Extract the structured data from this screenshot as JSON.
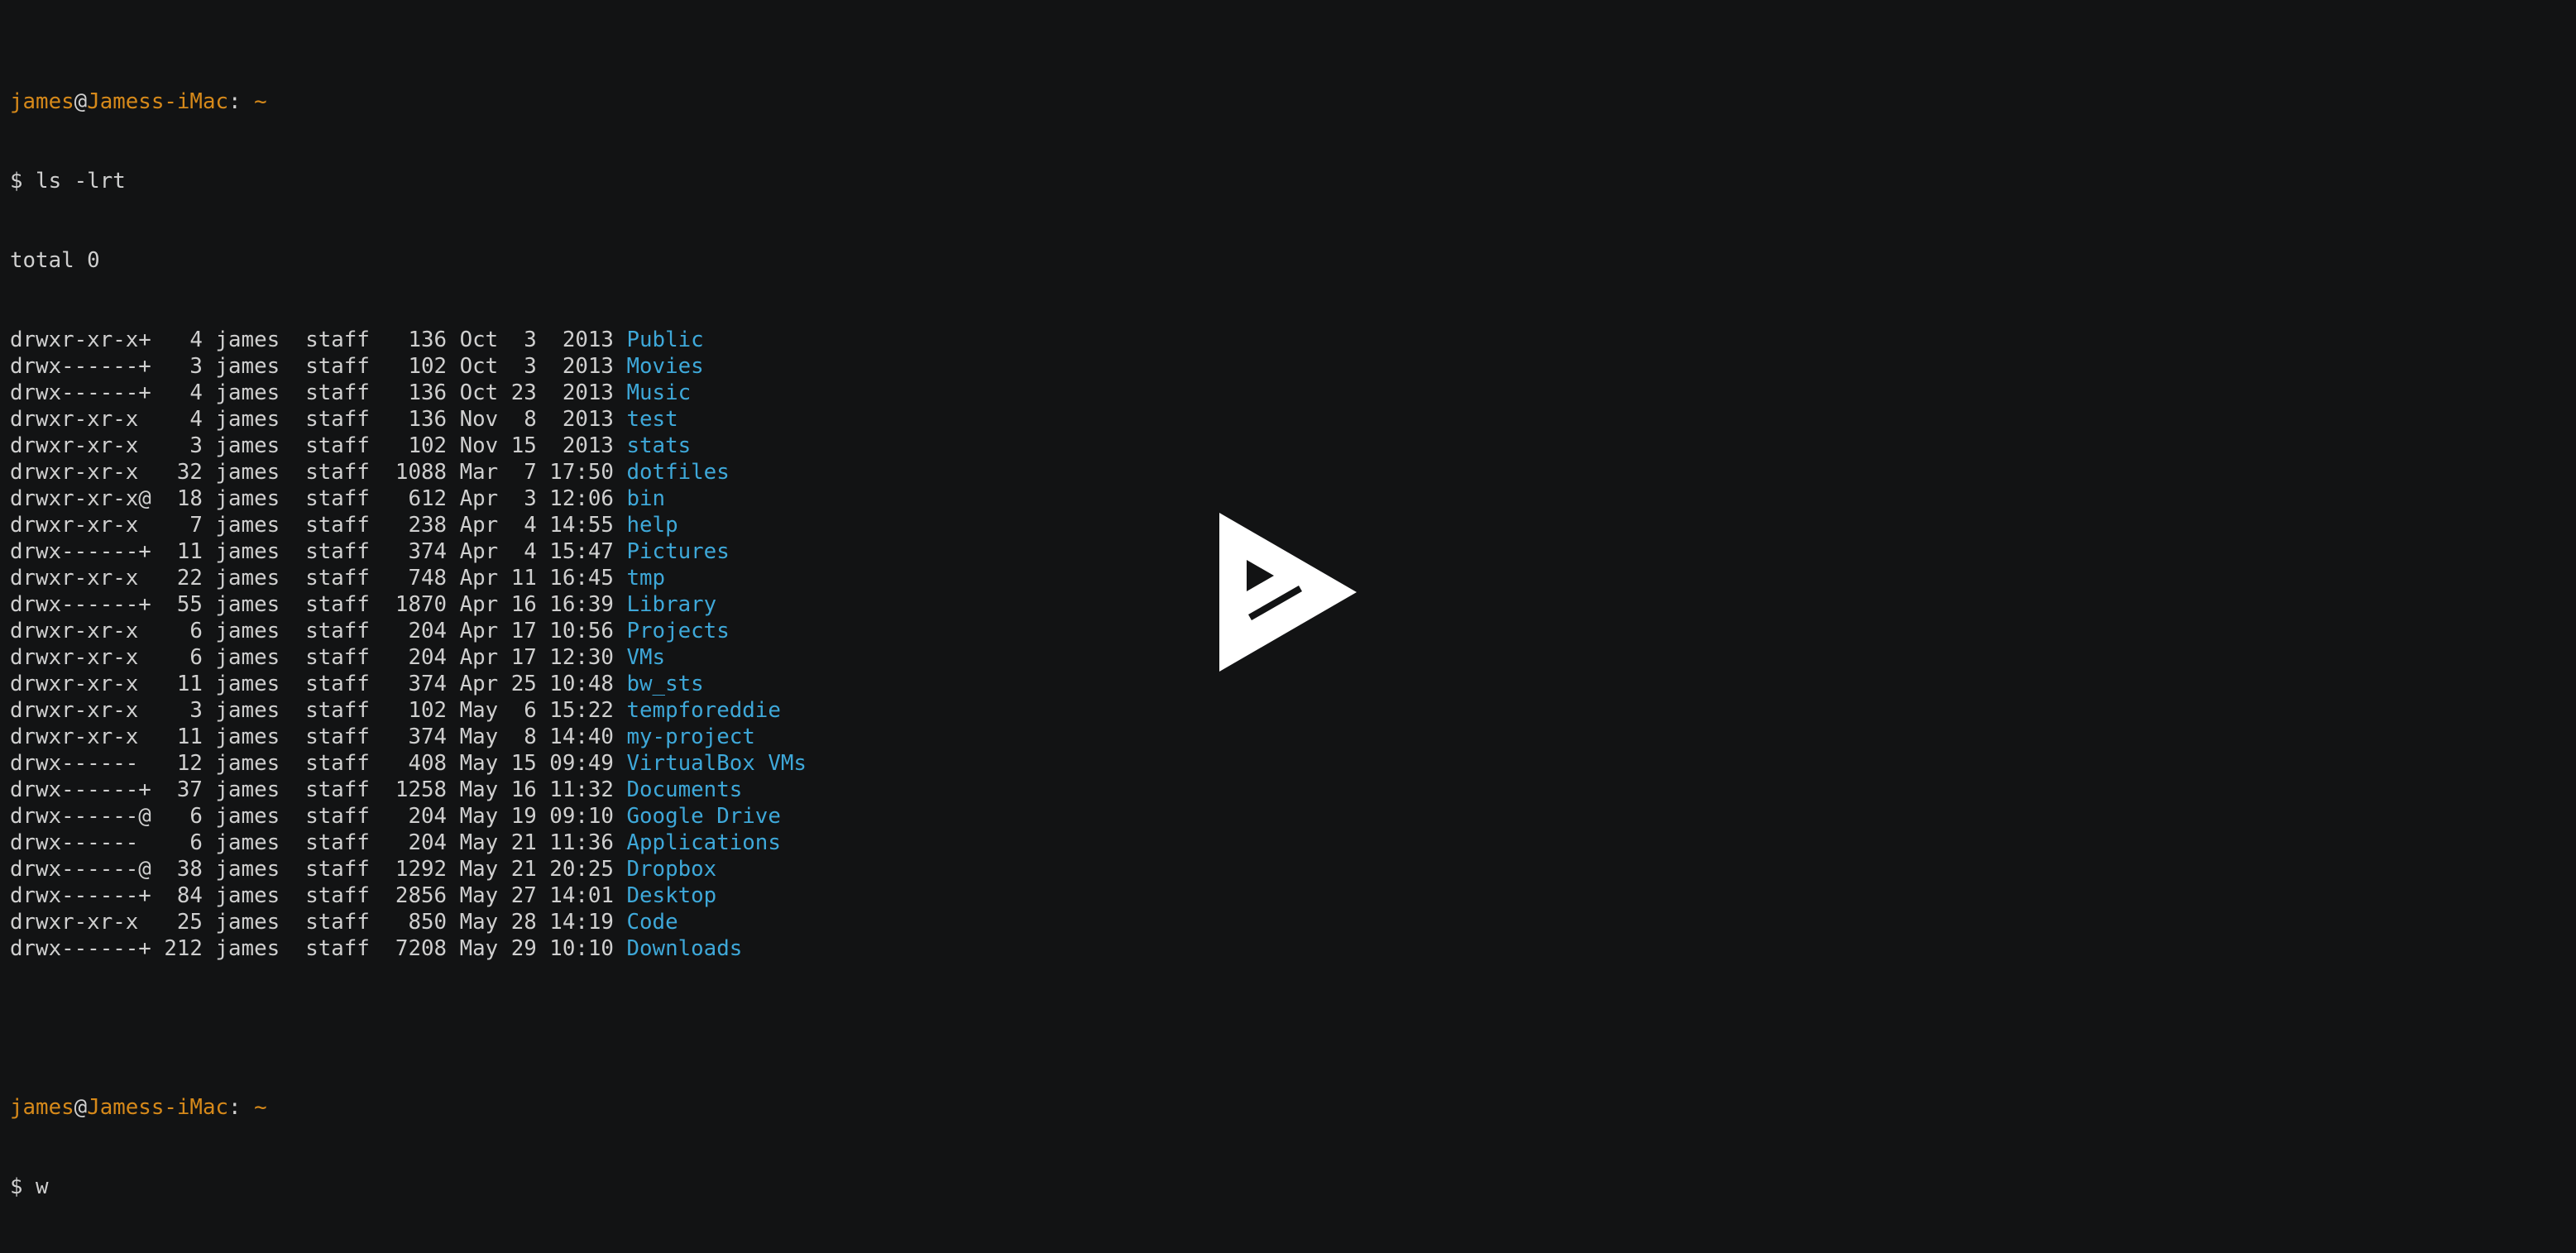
{
  "prompt1": {
    "user": "james",
    "at": "@",
    "host": "Jamess-iMac",
    "colon": ":",
    "path": "~"
  },
  "cmd1": "$ ls -lrt",
  "total": "total 0",
  "rows": [
    {
      "meta": "drwxr-xr-x+   4 james  staff   136 Oct  3  2013 ",
      "name": "Public"
    },
    {
      "meta": "drwx------+   3 james  staff   102 Oct  3  2013 ",
      "name": "Movies"
    },
    {
      "meta": "drwx------+   4 james  staff   136 Oct 23  2013 ",
      "name": "Music"
    },
    {
      "meta": "drwxr-xr-x    4 james  staff   136 Nov  8  2013 ",
      "name": "test"
    },
    {
      "meta": "drwxr-xr-x    3 james  staff   102 Nov 15  2013 ",
      "name": "stats"
    },
    {
      "meta": "drwxr-xr-x   32 james  staff  1088 Mar  7 17:50 ",
      "name": "dotfiles"
    },
    {
      "meta": "drwxr-xr-x@  18 james  staff   612 Apr  3 12:06 ",
      "name": "bin"
    },
    {
      "meta": "drwxr-xr-x    7 james  staff   238 Apr  4 14:55 ",
      "name": "help"
    },
    {
      "meta": "drwx------+  11 james  staff   374 Apr  4 15:47 ",
      "name": "Pictures"
    },
    {
      "meta": "drwxr-xr-x   22 james  staff   748 Apr 11 16:45 ",
      "name": "tmp"
    },
    {
      "meta": "drwx------+  55 james  staff  1870 Apr 16 16:39 ",
      "name": "Library"
    },
    {
      "meta": "drwxr-xr-x    6 james  staff   204 Apr 17 10:56 ",
      "name": "Projects"
    },
    {
      "meta": "drwxr-xr-x    6 james  staff   204 Apr 17 12:30 ",
      "name": "VMs"
    },
    {
      "meta": "drwxr-xr-x   11 james  staff   374 Apr 25 10:48 ",
      "name": "bw_sts"
    },
    {
      "meta": "drwxr-xr-x    3 james  staff   102 May  6 15:22 ",
      "name": "tempforeddie"
    },
    {
      "meta": "drwxr-xr-x   11 james  staff   374 May  8 14:40 ",
      "name": "my-project"
    },
    {
      "meta": "drwx------   12 james  staff   408 May 15 09:49 ",
      "name": "VirtualBox VMs"
    },
    {
      "meta": "drwx------+  37 james  staff  1258 May 16 11:32 ",
      "name": "Documents"
    },
    {
      "meta": "drwx------@   6 james  staff   204 May 19 09:10 ",
      "name": "Google Drive"
    },
    {
      "meta": "drwx------    6 james  staff   204 May 21 11:36 ",
      "name": "Applications"
    },
    {
      "meta": "drwx------@  38 james  staff  1292 May 21 20:25 ",
      "name": "Dropbox"
    },
    {
      "meta": "drwx------+  84 james  staff  2856 May 27 14:01 ",
      "name": "Desktop"
    },
    {
      "meta": "drwxr-xr-x   25 james  staff   850 May 28 14:19 ",
      "name": "Code"
    },
    {
      "meta": "drwx------+ 212 james  staff  7208 May 29 10:10 ",
      "name": "Downloads"
    }
  ],
  "prompt2": {
    "user": "james",
    "at": "@",
    "host": "Jamess-iMac",
    "colon": ":",
    "path": "~"
  },
  "cmd2": "$ w",
  "overlay": {
    "icon": "play-icon"
  },
  "colors": {
    "background": "#121314",
    "text": "#cfcfcf",
    "prompt": "#d6891a",
    "directory": "#3ea8d9",
    "overlay": "#ffffff"
  }
}
